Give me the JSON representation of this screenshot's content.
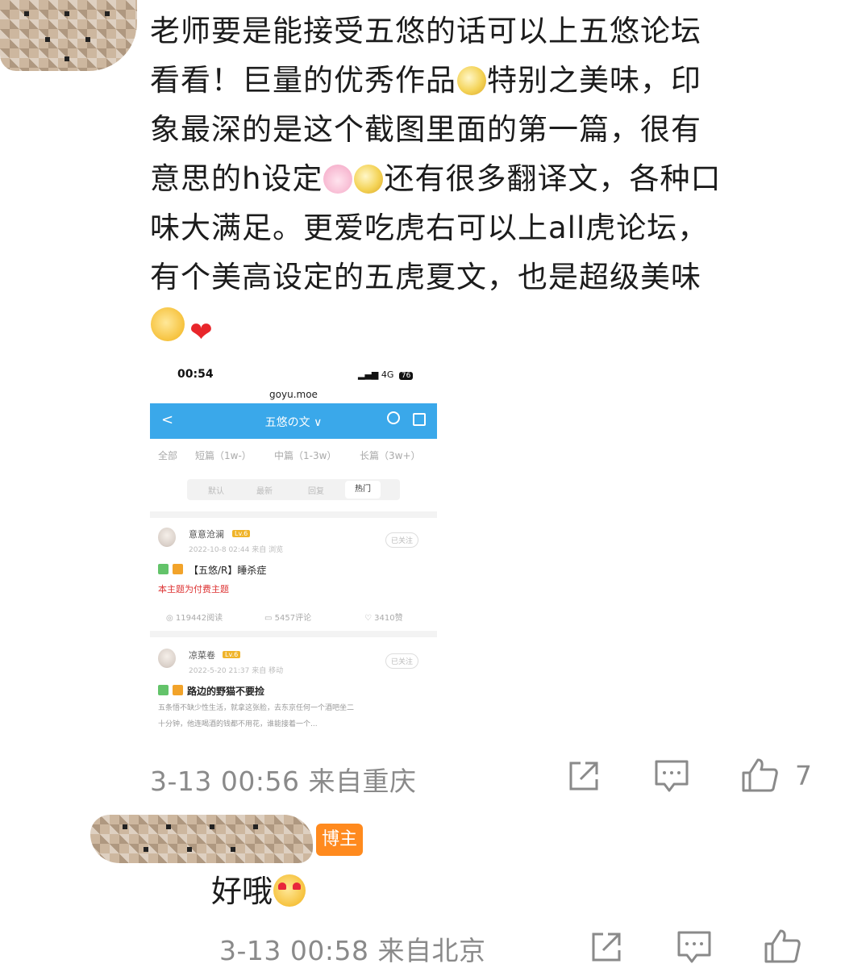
{
  "comment": {
    "author_hidden": true,
    "lines": [
      "老师要是能接受五悠的话可以上五悠论坛",
      "看看！巨量的优秀作品",
      "特别之美味，印",
      "象最深的是这个截图里面的第一篇，很有",
      "意思的h设定",
      "还有很多翻译文，各种口",
      "味大满足。更爱吃虎右可以上all虎论坛，",
      "有个美高设定的五虎夏文，也是超级美味"
    ],
    "timestamp": "3-13 00:56 来自重庆",
    "like_count": "7"
  },
  "screenshot": {
    "status_time": "00:54",
    "status_net": "4G",
    "status_battery": "76",
    "url": "goyu.moe",
    "nav_back": "<",
    "nav_title": "五悠の文 ∨",
    "filters": [
      "全部",
      "短篇（1w-）",
      "中篇（1-3w）",
      "长篇（3w+）"
    ],
    "sort": [
      "默认",
      "最新",
      "回复",
      "热门"
    ],
    "posts": [
      {
        "author": "意意沧澜",
        "level": "Lv.6",
        "meta": "2022-10-8 02:44  来自 浏览",
        "follow": "已关注",
        "title": "【五悠/R】睡杀症",
        "paid": "本主题为付费主题",
        "views": "119442阅读",
        "comments": "5457评论",
        "likes": "3410赞"
      },
      {
        "author": "凉菜卷",
        "level": "Lv.6",
        "meta": "2022-5-20 21:37  来自 移动",
        "follow": "已关注",
        "title": "路边的野猫不要捡",
        "excerpt_1": "五条悟不缺少性生活，就拿这张脸，去东京任何一个酒吧坐二",
        "excerpt_2": "十分钟，他连喝酒的钱都不用花，谁能接着一个..."
      }
    ]
  },
  "reply": {
    "author_hidden": true,
    "badge": "博主",
    "text": "好哦",
    "timestamp": "3-13 00:58 来自北京"
  },
  "colors": {
    "nav_blue": "#3aa8ea",
    "badge_orange": "#ff8a1e",
    "meta_gray": "#8a8a8a"
  },
  "icons": [
    "share-icon",
    "comment-icon",
    "like-icon",
    "heart-icon"
  ]
}
